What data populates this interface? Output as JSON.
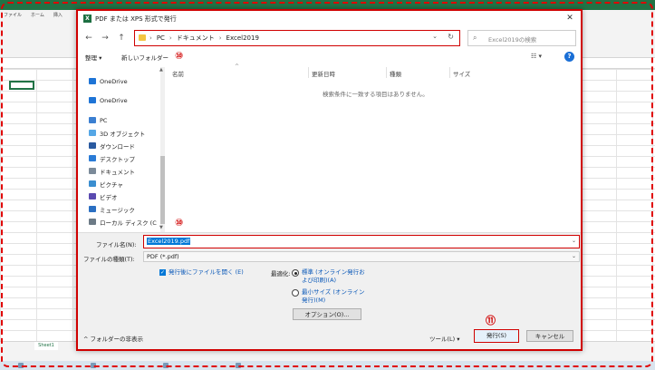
{
  "dialog": {
    "title": "PDF または XPS 形式で発行",
    "app_icon": "excel-icon",
    "close_label": "✕"
  },
  "address": {
    "crumbs": [
      "PC",
      "ドキュメント",
      "Excel2019"
    ],
    "separator": "›",
    "dropdown": "⌄",
    "refresh": "↻"
  },
  "nav_buttons": {
    "back": "←",
    "forward": "→",
    "up": "↑"
  },
  "search": {
    "placeholder": "Excel2019の検索",
    "icon": "⌕"
  },
  "toolbar": {
    "organize": "整理 ▾",
    "new_folder": "新しいフォルダー",
    "view": "☷ ▾",
    "help": "?"
  },
  "annotations": {
    "a10": "⑩",
    "b10": "⑩",
    "c11": "⑪"
  },
  "nav_pane": [
    {
      "label": "OneDrive",
      "icon": "cloud-icon",
      "color": "#1e74d6"
    },
    {
      "label": "OneDrive",
      "icon": "cloud-icon",
      "color": "#1e74d6"
    },
    {
      "label": "PC",
      "icon": "computer-icon",
      "color": "#3b7fd1"
    },
    {
      "label": "3D オブジェクト",
      "icon": "cube-icon",
      "color": "#55a7e6"
    },
    {
      "label": "ダウンロード",
      "icon": "download-icon",
      "color": "#2a5aa0"
    },
    {
      "label": "デスクトップ",
      "icon": "desktop-icon",
      "color": "#2a7bd6"
    },
    {
      "label": "ドキュメント",
      "icon": "document-icon",
      "color": "#7b8a99"
    },
    {
      "label": "ピクチャ",
      "icon": "pictures-icon",
      "color": "#3a8ed0"
    },
    {
      "label": "ビデオ",
      "icon": "video-icon",
      "color": "#5a4ab0"
    },
    {
      "label": "ミュージック",
      "icon": "music-icon",
      "color": "#2b6fc2"
    },
    {
      "label": "ローカル ディスク (C",
      "icon": "disk-icon",
      "color": "#6c7a86"
    },
    {
      "label": "ネットワーク",
      "icon": "network-icon",
      "color": "#3b7fd1"
    }
  ],
  "file_list": {
    "columns": [
      "名前",
      "更新日時",
      "種類",
      "サイズ"
    ],
    "empty_message": "検索条件に一致する項目はありません。"
  },
  "form": {
    "file_name_label": "ファイル名(N):",
    "file_name_value": "Excel2019.pdf",
    "file_type_label": "ファイルの種類(T):",
    "file_type_value": "PDF (*.pdf)",
    "open_after_label": "発行後にファイルを開く (E)",
    "open_after_checked": true,
    "optimize_label": "最適化:",
    "optimize_standard": "標準 (オンライン発行および印刷)(A)",
    "optimize_minimum": "最小サイズ (オンライン発行)(M)",
    "options_button": "オプション(O)...",
    "hide_folders": "^ フォルダーの非表示",
    "tools": "ツール(L) ▾",
    "publish": "発行(S)",
    "cancel": "キャンセル"
  },
  "excel_bg": {
    "tabs": [
      "ファイル",
      "ホーム",
      "挿入"
    ],
    "sheet_tab": "Sheet1"
  },
  "colors": {
    "accent_red": "#d00000",
    "excel_green": "#217346",
    "link_blue": "#0a58b8"
  }
}
